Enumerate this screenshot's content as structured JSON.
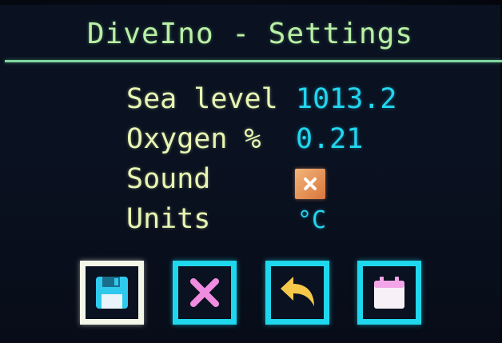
{
  "title": "DiveIno - Settings",
  "settings": [
    {
      "label": "Sea level",
      "value": "1013.2"
    },
    {
      "label": "Oxygen %",
      "value": "0.21"
    },
    {
      "label": "Sound",
      "checked": false
    },
    {
      "label": "Units",
      "value": "°C"
    }
  ],
  "buttons": [
    {
      "name": "save",
      "icon": "floppy-disk-icon",
      "selected": true
    },
    {
      "name": "cancel",
      "icon": "x-icon",
      "selected": false
    },
    {
      "name": "back",
      "icon": "undo-arrow-icon",
      "selected": false
    },
    {
      "name": "calendar",
      "icon": "calendar-icon",
      "selected": false
    }
  ],
  "colors": {
    "title": "#b9f0a6",
    "label": "#e8f6b4",
    "value": "#22d6f0",
    "button_border": "#1fd7ec",
    "selected_border": "#f3f7e8",
    "checkbox": "#e29158",
    "cancel_x": "#f08ce0",
    "back_arrow": "#f5c84a",
    "calendar": "#f2a6e8"
  }
}
